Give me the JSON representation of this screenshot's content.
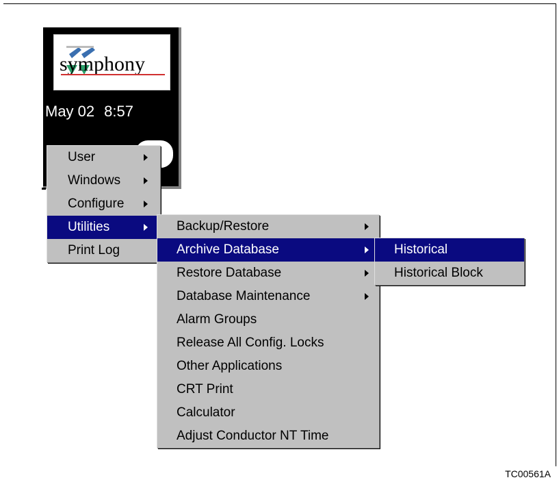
{
  "logo": {
    "text": "symphony"
  },
  "status": {
    "date": "May 02",
    "time": "8:57"
  },
  "main_menu": {
    "items": [
      {
        "label": "User",
        "submenu": true,
        "selected": false
      },
      {
        "label": "Windows",
        "submenu": true,
        "selected": false
      },
      {
        "label": "Configure",
        "submenu": true,
        "selected": false
      },
      {
        "label": "Utilities",
        "submenu": true,
        "selected": true
      },
      {
        "label": "Print Log",
        "submenu": false,
        "selected": false
      }
    ]
  },
  "utilities_menu": {
    "items": [
      {
        "label": "Backup/Restore",
        "submenu": true,
        "selected": false
      },
      {
        "label": "Archive Database",
        "submenu": true,
        "selected": true
      },
      {
        "label": "Restore Database",
        "submenu": true,
        "selected": false
      },
      {
        "label": "Database Maintenance",
        "submenu": true,
        "selected": false
      },
      {
        "label": "Alarm Groups",
        "submenu": false,
        "selected": false
      },
      {
        "label": "Release All Config. Locks",
        "submenu": false,
        "selected": false
      },
      {
        "label": "Other Applications",
        "submenu": false,
        "selected": false
      },
      {
        "label": "CRT Print",
        "submenu": false,
        "selected": false
      },
      {
        "label": "Calculator",
        "submenu": false,
        "selected": false
      },
      {
        "label": "Adjust Conductor NT Time",
        "submenu": false,
        "selected": false
      }
    ]
  },
  "archive_menu": {
    "items": [
      {
        "label": "Historical",
        "submenu": false,
        "selected": true
      },
      {
        "label": "Historical Block",
        "submenu": false,
        "selected": false
      }
    ]
  },
  "figure_id": "TC00561A",
  "colors": {
    "menu_background": "#c0c0c0",
    "selection": "#0a0a80",
    "panel_background": "#000000"
  }
}
